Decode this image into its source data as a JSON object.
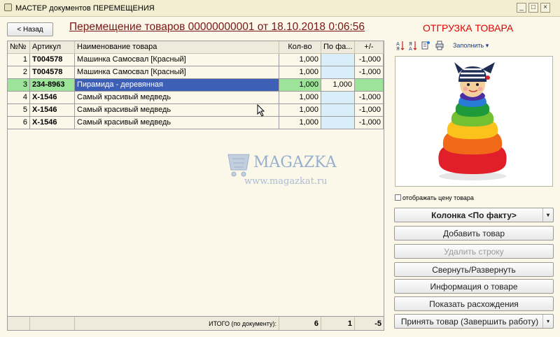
{
  "window": {
    "title": "МАСТЕР документов ПЕРЕМЕЩЕНИЯ",
    "controls": {
      "minimize": "_",
      "maximize": "□",
      "close": "×"
    }
  },
  "header": {
    "back_label": "< Назад",
    "doc_title": "Перемещение товаров 00000000001 от 18.10.2018 0:06:56",
    "section_title": "ОТГРУЗКА ТОВАРА"
  },
  "table": {
    "columns": [
      "№№",
      "Артикул",
      "Наименование товара",
      "Кол-во",
      "По фа...",
      "+/-"
    ],
    "rows": [
      {
        "n": "1",
        "sku": "T004578",
        "name": "Машинка Самосвал [Красный]",
        "qty": "1,000",
        "fact": "",
        "diff": "-1,000"
      },
      {
        "n": "2",
        "sku": "T004578",
        "name": "Машинка Самосвал [Красный]",
        "qty": "1,000",
        "fact": "",
        "diff": "-1,000"
      },
      {
        "n": "3",
        "sku": "234-8963",
        "name": "Пирамида - деревянная",
        "qty": "1,000",
        "fact": "1,000",
        "diff": ""
      },
      {
        "n": "4",
        "sku": "X-1546",
        "name": "Самый красивый медведь",
        "qty": "1,000",
        "fact": "",
        "diff": "-1,000"
      },
      {
        "n": "5",
        "sku": "X-1546",
        "name": "Самый красивый медведь",
        "qty": "1,000",
        "fact": "",
        "diff": "-1,000"
      },
      {
        "n": "6",
        "sku": "X-1546",
        "name": "Самый красивый медведь",
        "qty": "1,000",
        "fact": "",
        "diff": "-1,000"
      }
    ],
    "selected_row": 3,
    "footer": {
      "label": "ИТОГО (по документу):",
      "qty_total": "6",
      "fact_total": "1",
      "diff_total": "-5"
    }
  },
  "watermark": {
    "brand": "MAGAZKA",
    "url": "www.magazkat.ru"
  },
  "right_panel": {
    "toolbar": {
      "icons": [
        "sort-ascending-icon",
        "sort-descending-icon",
        "list-settings-icon",
        "print-icon"
      ],
      "fill_label": "Заполнить"
    },
    "product_image": "toy-stacking-pyramid",
    "show_price_label": "отображать цену товара",
    "show_price_checked": false,
    "buttons": {
      "column_fact": "Колонка <По факту>",
      "add_product": "Добавить товар",
      "delete_row": "Удалить строку",
      "collapse_expand": "Свернуть/Развернуть",
      "product_info": "Информация о товаре",
      "show_diffs": "Показать расхождения",
      "accept": "Принять товар (Завершить работу)"
    }
  },
  "colors": {
    "window_bg": "#fbf8e9",
    "title_accent": "#e00000",
    "doc_title": "#7a1616",
    "selected_row": "#9ee39a",
    "selected_cell": "#3d5fb5",
    "fact_cell": "#d8eef8"
  }
}
